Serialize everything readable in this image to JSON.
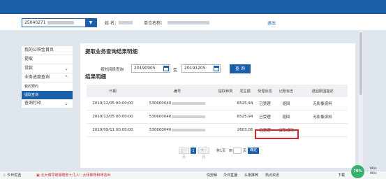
{
  "header": {
    "account_prefix": "25040271",
    "name_label": "姓 名：",
    "unit_label": "单位名称：",
    "logout": "退出"
  },
  "sidebar": {
    "items": [
      {
        "label": "我的公积金首页"
      },
      {
        "label": "提取"
      },
      {
        "label": "贷款"
      },
      {
        "label": "业务进度查询"
      },
      {
        "label": "我的预约"
      },
      {
        "label": "提取查询"
      },
      {
        "label": "查询打印"
      }
    ]
  },
  "page": {
    "title": "提取业务查询结果明细",
    "date_label": "按时间段查询",
    "start_date": "20190905",
    "to_label": "至",
    "end_date": "20191205",
    "query_button": "查 询",
    "section_title": "结果明细"
  },
  "table": {
    "headers": [
      "日期",
      "编号",
      "提取种类",
      "发生额",
      "受理状态",
      "记账标志",
      "退回原因描述"
    ],
    "rows": [
      {
        "date": "2019/12/05 00:00:00",
        "id": "530600040",
        "kind": "",
        "amount": "6525.94",
        "status": "已受理",
        "flag": "退回",
        "reason": "无影像资料"
      },
      {
        "date": "2019/12/05 00:00:00",
        "id": "530600040",
        "kind": "",
        "amount": "6525.94",
        "status": "已受理",
        "flag": "退回",
        "reason": "无影像资料"
      },
      {
        "date": "2019/09/11 00:00:00",
        "id": "530600040",
        "kind": "",
        "amount": "2603.06",
        "status": "已受理",
        "flag": "记账成功",
        "reason": ""
      }
    ]
  },
  "pager": {
    "first": "上一页",
    "page": "1",
    "next": "下一页",
    "total": "共1页",
    "goto": "到",
    "page_unit": "页",
    "confirm": "确定"
  },
  "statusbar": {
    "fav": "今日优选",
    "news": "北大博导被爆聘娶十几人！大师推荐和珅逃出",
    "items": [
      "快剪辑",
      "今日直播",
      "头条推荐",
      "热点资讯",
      "下载"
    ],
    "gauge": "76%",
    "speed_up": "0K/s",
    "speed_down": "0K/s"
  }
}
